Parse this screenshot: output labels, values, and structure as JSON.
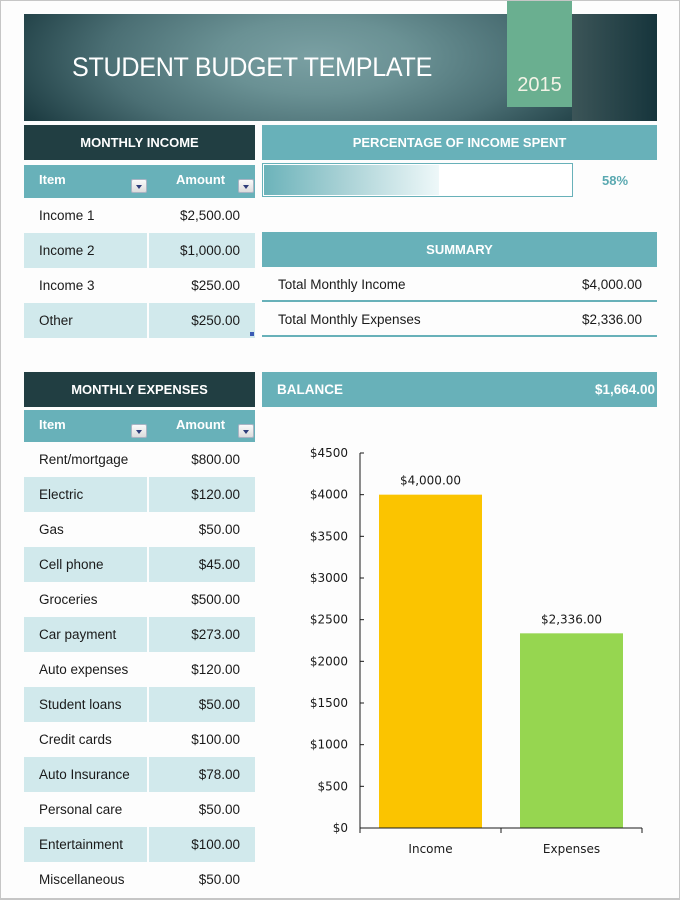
{
  "header": {
    "title": "STUDENT BUDGET TEMPLATE",
    "year": "2015"
  },
  "colors": {
    "dark_header": "#213e42",
    "teal": "#68b1b9",
    "alt_row": "#d1e9ec",
    "year_tab": "#6aaf90",
    "income_bar": "#fbc400",
    "expenses_bar": "#96d650"
  },
  "income": {
    "title": "MONTHLY INCOME",
    "columns": [
      "Item",
      "Amount"
    ],
    "rows": [
      {
        "item": "Income 1",
        "amount": "$2,500.00"
      },
      {
        "item": "Income 2",
        "amount": "$1,000.00"
      },
      {
        "item": "Income 3",
        "amount": "$250.00"
      },
      {
        "item": "Other",
        "amount": "$250.00"
      }
    ]
  },
  "percentage": {
    "title": "PERCENTAGE OF INCOME SPENT",
    "value": 58,
    "label": "58%"
  },
  "summary": {
    "title": "SUMMARY",
    "rows": [
      {
        "label": "Total Monthly Income",
        "value": "$4,000.00"
      },
      {
        "label": "Total Monthly Expenses",
        "value": "$2,336.00"
      }
    ]
  },
  "expenses": {
    "title": "MONTHLY EXPENSES",
    "columns": [
      "Item",
      "Amount"
    ],
    "rows": [
      {
        "item": "Rent/mortgage",
        "amount": "$800.00"
      },
      {
        "item": "Electric",
        "amount": "$120.00"
      },
      {
        "item": "Gas",
        "amount": "$50.00"
      },
      {
        "item": "Cell phone",
        "amount": "$45.00"
      },
      {
        "item": "Groceries",
        "amount": "$500.00"
      },
      {
        "item": "Car payment",
        "amount": "$273.00"
      },
      {
        "item": "Auto expenses",
        "amount": "$120.00"
      },
      {
        "item": "Student loans",
        "amount": "$50.00"
      },
      {
        "item": "Credit cards",
        "amount": "$100.00"
      },
      {
        "item": "Auto Insurance",
        "amount": "$78.00"
      },
      {
        "item": "Personal care",
        "amount": "$50.00"
      },
      {
        "item": "Entertainment",
        "amount": "$100.00"
      },
      {
        "item": "Miscellaneous",
        "amount": "$50.00"
      }
    ]
  },
  "balance": {
    "label": "BALANCE",
    "value": "$1,664.00"
  },
  "chart_data": {
    "type": "bar",
    "title": "",
    "xlabel": "",
    "ylabel": "",
    "categories": [
      "Income",
      "Expenses"
    ],
    "values": [
      4000,
      2336
    ],
    "data_labels": [
      "$4,000.00",
      "$2,336.00"
    ],
    "ylim": [
      0,
      4500
    ],
    "yticks": [
      0,
      500,
      1000,
      1500,
      2000,
      2500,
      3000,
      3500,
      4000,
      4500
    ],
    "ytick_labels": [
      "$0",
      "$500",
      "$1000",
      "$1500",
      "$2000",
      "$2500",
      "$3000",
      "$3500",
      "$4000",
      "$4500"
    ],
    "grid": false,
    "legend": "none"
  }
}
